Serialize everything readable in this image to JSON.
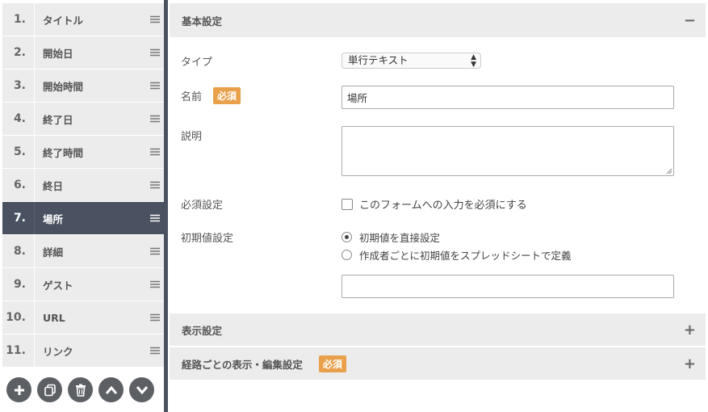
{
  "fields": [
    {
      "num": "1.",
      "label": "タイトル",
      "active": false
    },
    {
      "num": "2.",
      "label": "開始日",
      "active": false
    },
    {
      "num": "3.",
      "label": "開始時間",
      "active": false
    },
    {
      "num": "4.",
      "label": "終了日",
      "active": false
    },
    {
      "num": "5.",
      "label": "終了時間",
      "active": false
    },
    {
      "num": "6.",
      "label": "終日",
      "active": false
    },
    {
      "num": "7.",
      "label": "場所",
      "active": true
    },
    {
      "num": "8.",
      "label": "詳細",
      "active": false
    },
    {
      "num": "9.",
      "label": "ゲスト",
      "active": false
    },
    {
      "num": "10.",
      "label": "URL",
      "active": false
    },
    {
      "num": "11.",
      "label": "リンク",
      "active": false
    }
  ],
  "toolbar": {
    "icons": [
      "plus-icon",
      "copy-icon",
      "trash-icon",
      "chevron-up-icon",
      "chevron-down-icon"
    ]
  },
  "basic": {
    "title": "基本設定",
    "toggle": "−",
    "type_label": "タイプ",
    "type_value": "単行テキスト",
    "name_label": "名前",
    "required_badge": "必須",
    "name_value": "場所",
    "desc_label": "説明",
    "desc_value": "",
    "required_label": "必須設定",
    "required_checkbox_text": "このフォームへの入力を必須にする",
    "initial_label": "初期値設定",
    "initial_option1": "初期値を直接設定",
    "initial_option2": "作成者ごとに初期値をスプレッドシートで定義",
    "initial_value": ""
  },
  "display": {
    "title": "表示設定",
    "toggle": "+"
  },
  "route": {
    "title": "経路ごとの表示・編集設定",
    "badge": "必須",
    "toggle": "+"
  },
  "colors": {
    "active_bg": "#4a5261",
    "item_bg": "#ececec",
    "badge": "#e8a04a",
    "tool_btn": "#5c5f64"
  }
}
